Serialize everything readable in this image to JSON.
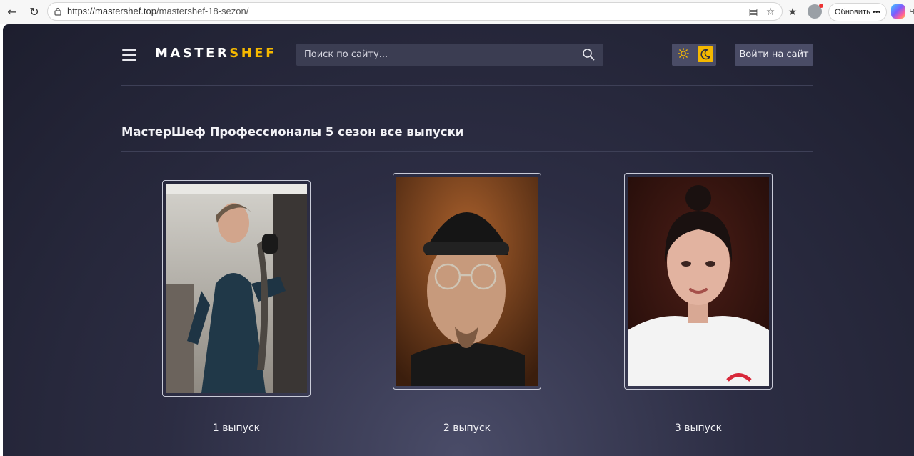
{
  "browser": {
    "url_host": "https://mastershef.top",
    "url_path": "/mastershef-18-sezon/",
    "update_label": "Обновить",
    "more_label": "•••",
    "extra_label": "Ч"
  },
  "header": {
    "logo_part1": "MASTER",
    "logo_part2": "SHEF",
    "search_placeholder": "Поиск по сайту...",
    "login_label": "Войти на сайт"
  },
  "main": {
    "title": "МастерШеф Профессионалы 5 сезон все выпуски",
    "episodes": [
      {
        "label": "1 выпуск"
      },
      {
        "label": "2 выпуск"
      },
      {
        "label": "3 выпуск"
      }
    ]
  },
  "colors": {
    "accent": "#f5b800",
    "background": "#25263a",
    "panel": "#3b3d52"
  }
}
